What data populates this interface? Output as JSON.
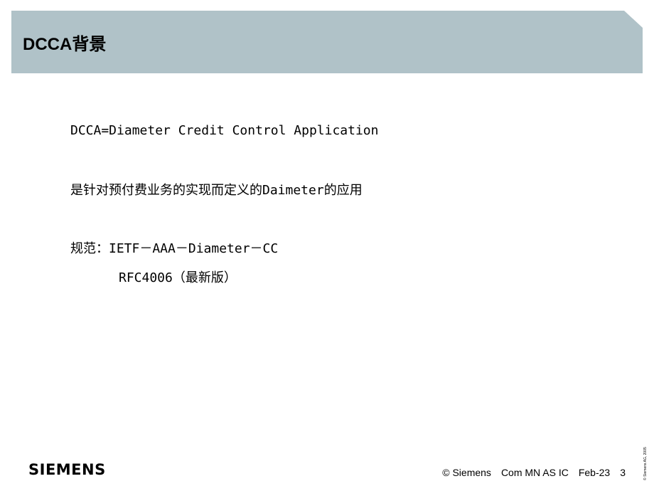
{
  "header": {
    "title": "DCCA背景",
    "band_color": "#b0c2c8"
  },
  "content": {
    "lines": [
      "DCCA=Diameter Credit Control Application",
      "是针对预付费业务的实现而定义的Daimeter的应用",
      "规范：IETF－AAA－Diameter－CC",
      "RFC4006（最新版）"
    ]
  },
  "footer": {
    "logo": "SIEMENS",
    "copyright": "© Siemens",
    "department": "Com MN AS IC",
    "date": "Feb-23",
    "page_number": "3",
    "vertical_notice": "© Siemens AG, 2005"
  }
}
